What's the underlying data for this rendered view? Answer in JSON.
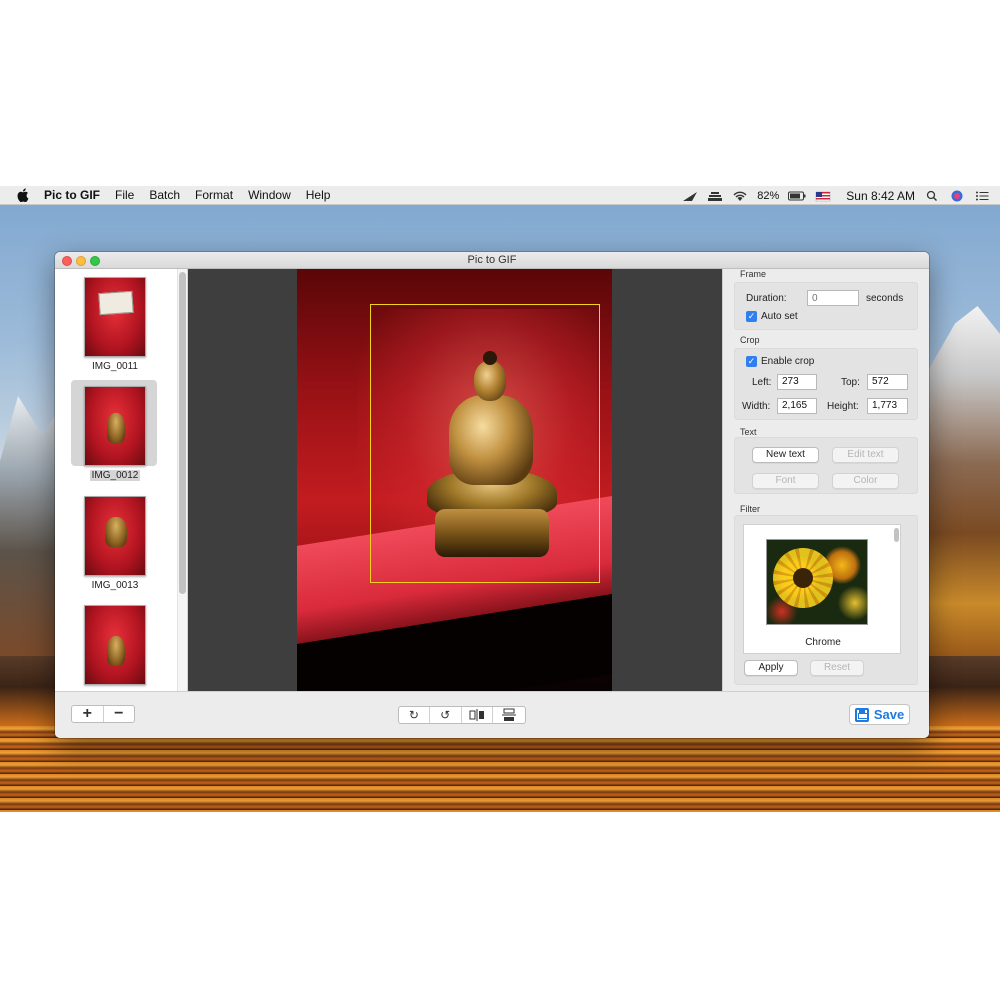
{
  "menubar": {
    "app_name": "Pic to GIF",
    "items": [
      "File",
      "Batch",
      "Format",
      "Window",
      "Help"
    ],
    "battery": "82%",
    "clock": "Sun 8:42 AM"
  },
  "window": {
    "title": "Pic to GIF"
  },
  "sidebar": {
    "items": [
      {
        "label": "IMG_0011",
        "selected": false
      },
      {
        "label": "IMG_0012",
        "selected": true
      },
      {
        "label": "IMG_0013",
        "selected": false
      },
      {
        "label": "",
        "selected": false
      }
    ]
  },
  "inspector": {
    "frame": {
      "title": "Frame",
      "duration_label": "Duration:",
      "duration_placeholder": "0",
      "duration_unit": "seconds",
      "auto_set_label": "Auto set",
      "auto_set_checked": true
    },
    "crop": {
      "title": "Crop",
      "enable_label": "Enable crop",
      "enable_checked": true,
      "left_label": "Left:",
      "left_value": "273",
      "top_label": "Top:",
      "top_value": "572",
      "width_label": "Width:",
      "width_value": "2,165",
      "height_label": "Height:",
      "height_value": "1,773"
    },
    "text": {
      "title": "Text",
      "new_text": "New text",
      "edit_text": "Edit text",
      "font": "Font",
      "color": "Color"
    },
    "filter": {
      "title": "Filter",
      "selected_filter": "Chrome",
      "apply": "Apply",
      "reset": "Reset"
    }
  },
  "toolbar": {
    "add_label": "+",
    "remove_label": "−",
    "rotate_cw": "↻",
    "rotate_ccw": "↺",
    "save_label": "Save"
  },
  "colors": {
    "accent": "#1f7ae0",
    "crop_outline": "#f5d21a",
    "checkbox": "#2f7ff0"
  }
}
